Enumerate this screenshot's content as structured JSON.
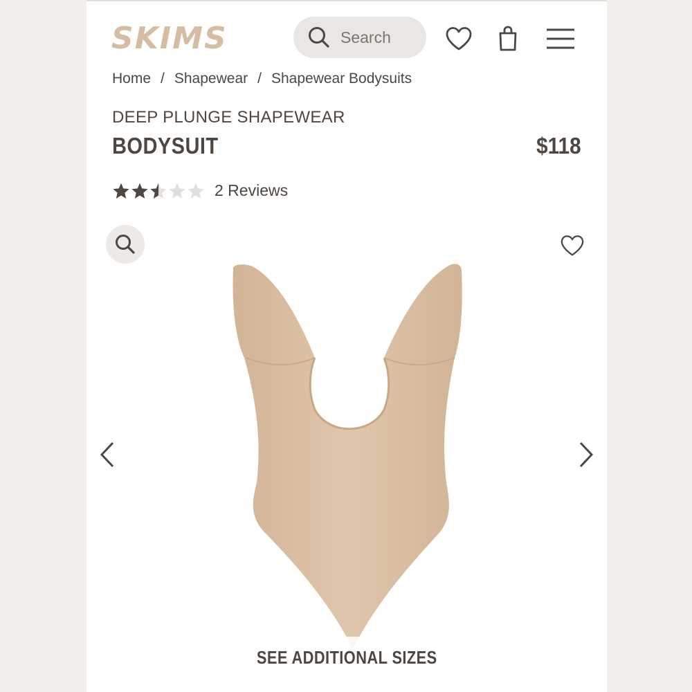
{
  "header": {
    "logo_text": "SKIMS",
    "search_label": "Search",
    "icons": [
      "search-icon",
      "heart-icon",
      "shopping-bag-icon",
      "menu-icon"
    ]
  },
  "breadcrumb": {
    "items": [
      "Home",
      "Shapewear",
      "Shapewear Bodysuits"
    ],
    "separator": "/"
  },
  "product": {
    "subtitle": "DEEP PLUNGE SHAPEWEAR",
    "title": "BODYSUIT",
    "price": "$118",
    "rating": 2.5,
    "rating_max": 5,
    "reviews_label": "2 Reviews",
    "image_color": "#dcc1a6"
  },
  "gallery": {
    "see_sizes_label": "SEE ADDITIONAL SIZES"
  },
  "colors": {
    "text": "#4e4640",
    "logo": "#d7bca4",
    "star_filled": "#4e4640",
    "star_empty": "#e2e0de",
    "background": "#f3efea"
  }
}
